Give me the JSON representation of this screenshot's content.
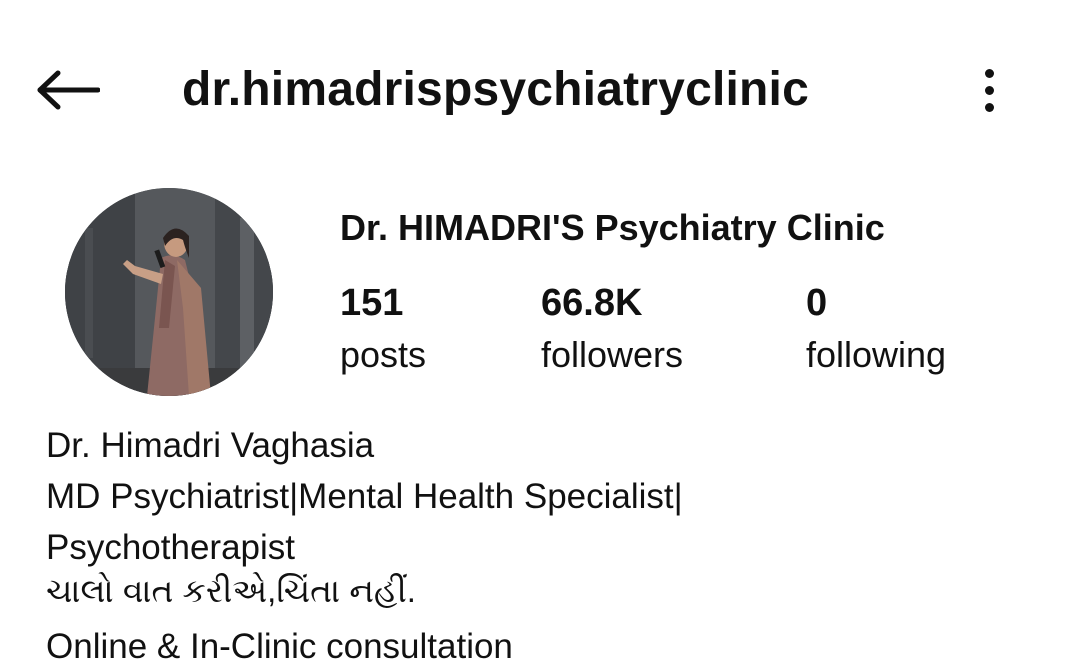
{
  "header": {
    "back_icon": "arrow-left-icon",
    "username": "dr.himadrispsychiatryclinic",
    "more_icon": "vertical-dots-icon"
  },
  "profile": {
    "display_name": "Dr. HIMADRI'S Psychiatry Clinic",
    "stats": [
      {
        "count": "151",
        "label": "posts"
      },
      {
        "count": "66.8K",
        "label": "followers"
      },
      {
        "count": "0",
        "label": "following"
      }
    ]
  },
  "bio": {
    "lines": [
      "Dr. Himadri Vaghasia",
      "MD Psychiatrist|Mental Health Specialist|",
      "Psychotherapist",
      "ચાલો વાત કરીએ,ચિંતા નહીં.",
      "Online & In-Clinic consultation"
    ]
  },
  "colors": {
    "text": "#111111",
    "background": "#ffffff"
  }
}
